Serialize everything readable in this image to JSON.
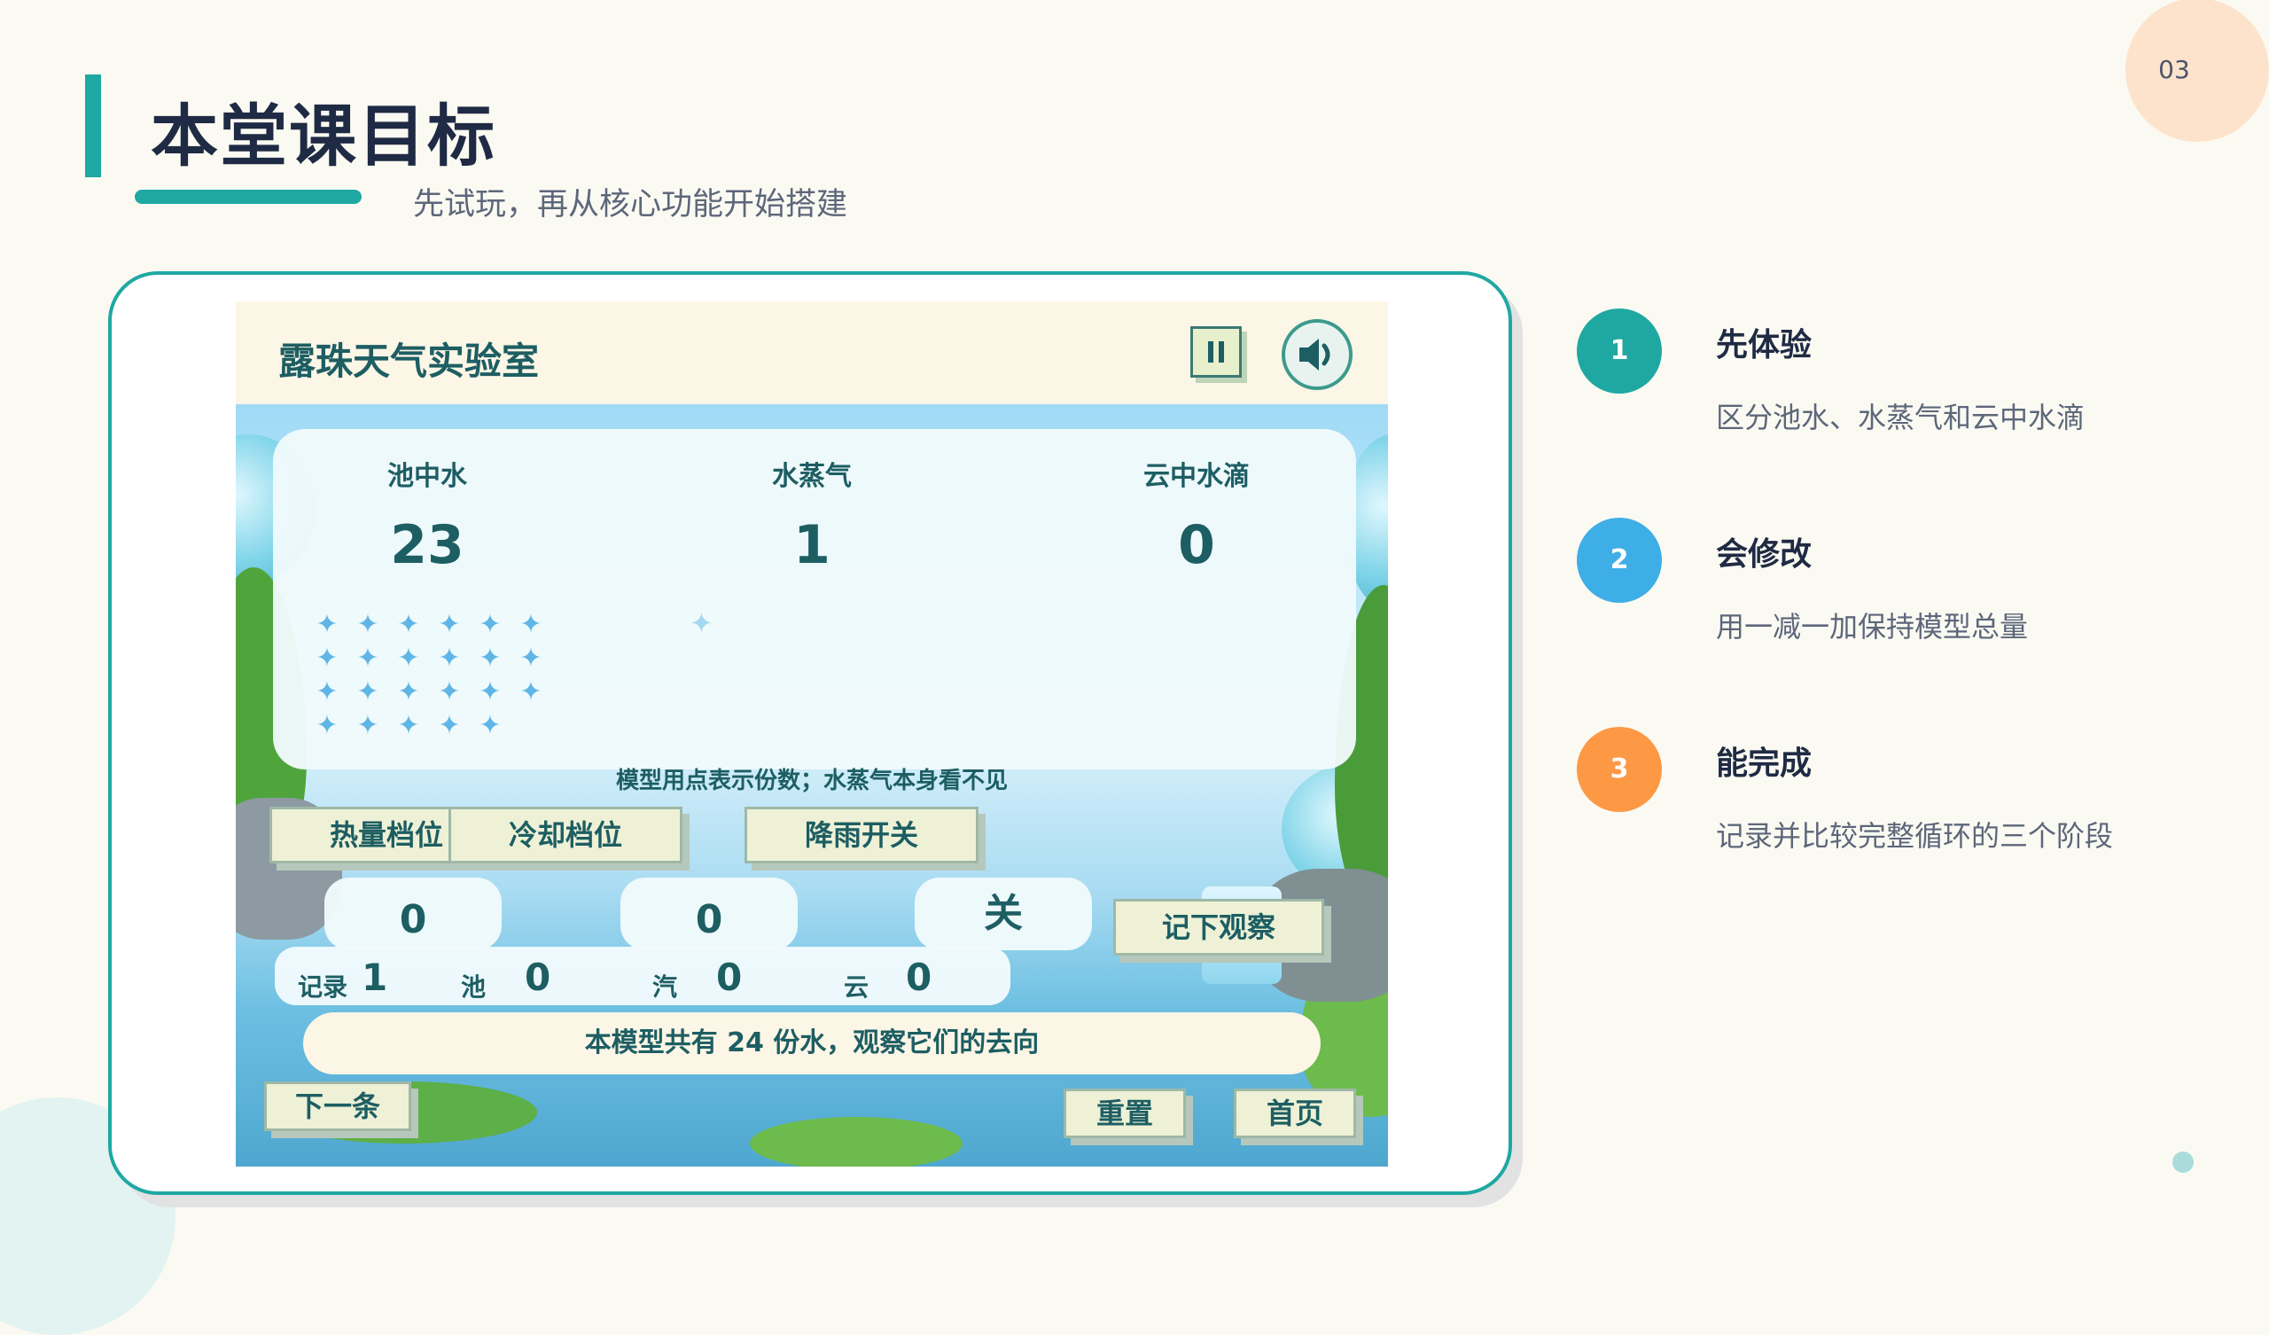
{
  "page": {
    "number": "03",
    "title": "本堂课目标",
    "subtitle": "先试玩，再从核心功能开始搭建"
  },
  "game": {
    "title": "露珠天气实验室",
    "icons": {
      "pause": "pause-icon",
      "sound": "speaker-icon",
      "drop": "water-drop-icon"
    },
    "columns": [
      {
        "label": "池中水",
        "count": "23"
      },
      {
        "label": "水蒸气",
        "count": "1"
      },
      {
        "label": "云中水滴",
        "count": "0"
      }
    ],
    "pool_drop_count": 23,
    "vapor_drop_count": 1,
    "hint": "模型用点表示份数；水蒸气本身看不见",
    "controls": {
      "heat": {
        "label": "热量档位",
        "value": "0"
      },
      "cool": {
        "label": "冷却档位",
        "value": "0"
      },
      "rain": {
        "label": "降雨开关",
        "value": "关"
      },
      "record": "记下观察"
    },
    "record": {
      "label": "记录",
      "index": "1",
      "pool_label": "池",
      "pool_value": "0",
      "vapor_label": "汽",
      "vapor_value": "0",
      "cloud_label": "云",
      "cloud_value": "0"
    },
    "info": "本模型共有 24 份水，观察它们的去向",
    "buttons": {
      "next": "下一条",
      "reset": "重置",
      "home": "首页"
    }
  },
  "goals": [
    {
      "num": "1",
      "title": "先体验",
      "desc": "区分池水、水蒸气和云中水滴",
      "color": "#1fa8a2"
    },
    {
      "num": "2",
      "title": "会修改",
      "desc": "用一减一加保持模型总量",
      "color": "#3eaee6"
    },
    {
      "num": "3",
      "title": "能完成",
      "desc": "记录并比较完整循环的三个阶段",
      "color": "#fd9845"
    }
  ]
}
